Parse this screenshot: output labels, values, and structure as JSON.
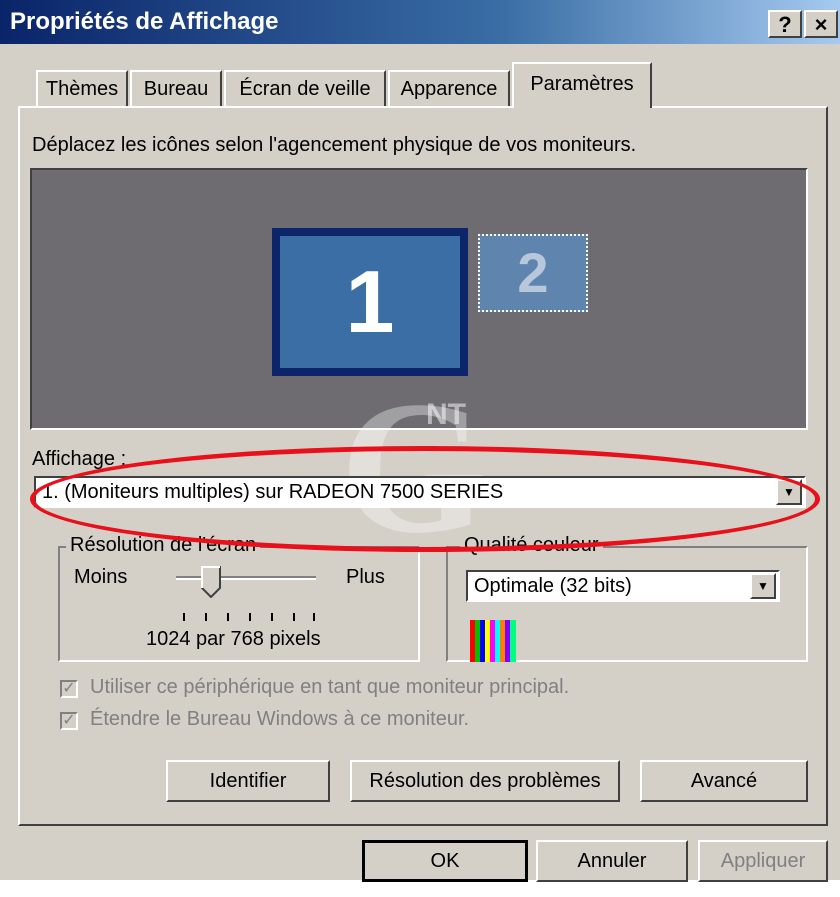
{
  "window": {
    "title": "Propriétés de Affichage",
    "help_label": "?",
    "close_label": "×"
  },
  "tabs": [
    "Thèmes",
    "Bureau",
    "Écran de veille",
    "Apparence",
    "Paramètres"
  ],
  "instruction": "Déplacez les icônes selon l'agencement physique de vos moniteurs.",
  "monitors": [
    {
      "label": "1",
      "primary": true
    },
    {
      "label": "2",
      "primary": false
    }
  ],
  "display": {
    "label": "Affichage :",
    "value": "1. (Moniteurs multiples) sur RADEON 7500 SERIES"
  },
  "resolution": {
    "group_label": "Résolution de l'écran",
    "less_label": "Moins",
    "more_label": "Plus",
    "value_text": "1024 par 768 pixels",
    "slider_position": 0.25
  },
  "color_quality": {
    "group_label": "Qualité couleur",
    "value": "Optimale (32 bits)"
  },
  "checkboxes": [
    {
      "label": "Utiliser ce périphérique en tant que moniteur principal.",
      "checked": true,
      "enabled": false
    },
    {
      "label": "Étendre le Bureau Windows à ce moniteur.",
      "checked": true,
      "enabled": false
    }
  ],
  "action_buttons": {
    "identify": "Identifier",
    "troubleshoot": "Résolution des problèmes",
    "advanced": "Avancé"
  },
  "dialog_buttons": {
    "ok": "OK",
    "cancel": "Annuler",
    "apply": "Appliquer"
  },
  "watermark": {
    "letter": "G",
    "text": "NT"
  },
  "colors": {
    "title_start": "#0a246a",
    "title_end": "#a6caf0",
    "monitor_selected": "#3a6ea5",
    "highlight_ellipse": "#e8101a",
    "face": "#d4d0c8"
  }
}
